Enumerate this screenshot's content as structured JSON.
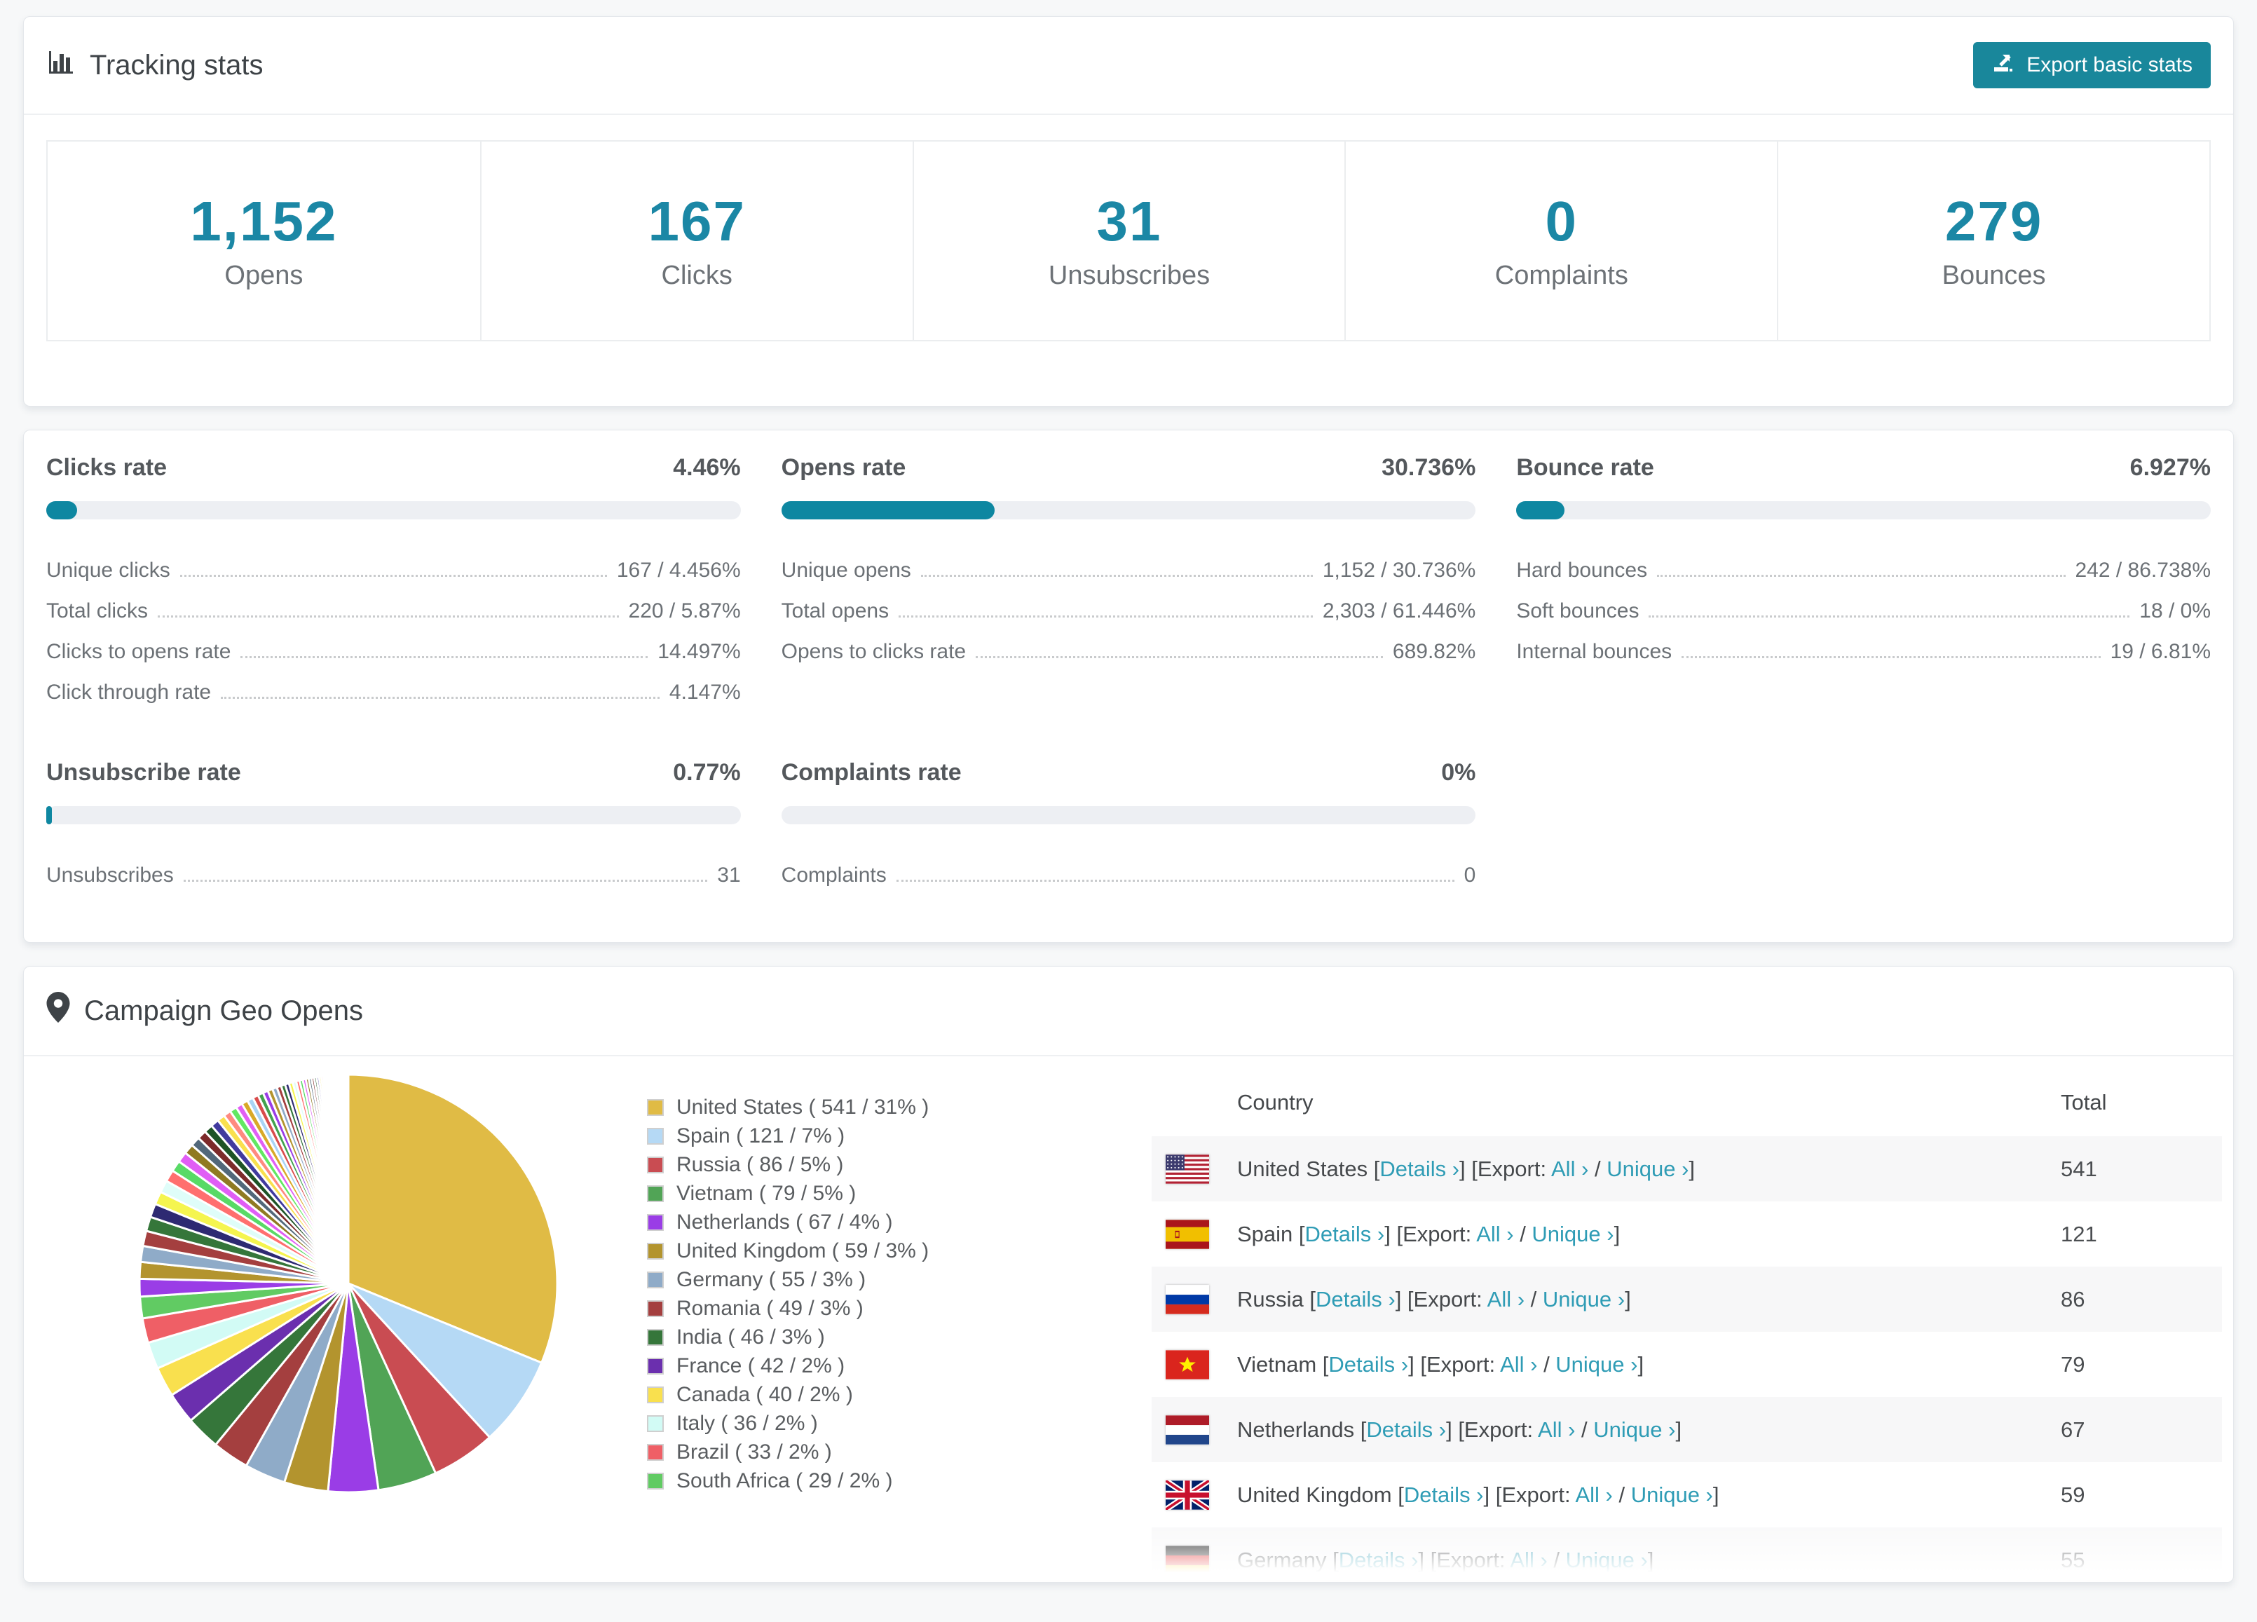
{
  "tracking": {
    "title": "Tracking stats",
    "export_label": "Export basic stats",
    "stats": [
      {
        "value": "1,152",
        "label": "Opens"
      },
      {
        "value": "167",
        "label": "Clicks"
      },
      {
        "value": "31",
        "label": "Unsubscribes"
      },
      {
        "value": "0",
        "label": "Complaints"
      },
      {
        "value": "279",
        "label": "Bounces"
      }
    ]
  },
  "rates": {
    "clicks": {
      "title": "Clicks rate",
      "value": "4.46%",
      "percent": 4.46,
      "rows": [
        {
          "label": "Unique clicks",
          "value": "167 / 4.456%"
        },
        {
          "label": "Total clicks",
          "value": "220 / 5.87%"
        },
        {
          "label": "Clicks to opens rate",
          "value": "14.497%"
        },
        {
          "label": "Click through rate",
          "value": "4.147%"
        }
      ]
    },
    "opens": {
      "title": "Opens rate",
      "value": "30.736%",
      "percent": 30.736,
      "rows": [
        {
          "label": "Unique opens",
          "value": "1,152 / 30.736%"
        },
        {
          "label": "Total opens",
          "value": "2,303 / 61.446%"
        },
        {
          "label": "Opens to clicks rate",
          "value": "689.82%"
        }
      ]
    },
    "bounce": {
      "title": "Bounce rate",
      "value": "6.927%",
      "percent": 6.927,
      "rows": [
        {
          "label": "Hard bounces",
          "value": "242 / 86.738%"
        },
        {
          "label": "Soft bounces",
          "value": "18 / 0%"
        },
        {
          "label": "Internal bounces",
          "value": "19 / 6.81%"
        }
      ]
    },
    "unsubscribe": {
      "title": "Unsubscribe rate",
      "value": "0.77%",
      "percent": 0.77,
      "rows": [
        {
          "label": "Unsubscribes",
          "value": "31"
        }
      ]
    },
    "complaints": {
      "title": "Complaints rate",
      "value": "0%",
      "percent": 0,
      "rows": [
        {
          "label": "Complaints",
          "value": "0"
        }
      ]
    }
  },
  "geo": {
    "title": "Campaign Geo Opens",
    "link_details": "Details ›",
    "link_export_label": "Export:",
    "link_all": "All ›",
    "link_unique": "Unique ›",
    "table": {
      "headers": [
        "Country",
        "Total"
      ],
      "rows": [
        {
          "country": "United States",
          "flag": "us",
          "total": "541"
        },
        {
          "country": "Spain",
          "flag": "es",
          "total": "121"
        },
        {
          "country": "Russia",
          "flag": "ru",
          "total": "86"
        },
        {
          "country": "Vietnam",
          "flag": "vn",
          "total": "79"
        },
        {
          "country": "Netherlands",
          "flag": "nl",
          "total": "67"
        },
        {
          "country": "United Kingdom",
          "flag": "gb",
          "total": "59"
        },
        {
          "country": "Germany",
          "flag": "de",
          "total": "55"
        }
      ]
    }
  },
  "chart_data": {
    "type": "pie",
    "title": "Campaign Geo Opens",
    "legend_position": "right",
    "start_angle": "top",
    "direction": "clockwise",
    "entries": [
      {
        "label": "United States",
        "value": 541,
        "pct": "31%",
        "color": "#e0bb45"
      },
      {
        "label": "Spain",
        "value": 121,
        "pct": "7%",
        "color": "#b5d9f5"
      },
      {
        "label": "Russia",
        "value": 86,
        "pct": "5%",
        "color": "#c94c52"
      },
      {
        "label": "Vietnam",
        "value": 79,
        "pct": "5%",
        "color": "#51a456"
      },
      {
        "label": "Netherlands",
        "value": 67,
        "pct": "4%",
        "color": "#9a3de6"
      },
      {
        "label": "United Kingdom",
        "value": 59,
        "pct": "3%",
        "color": "#b3942e"
      },
      {
        "label": "Germany",
        "value": 55,
        "pct": "3%",
        "color": "#8fabc8"
      },
      {
        "label": "Romania",
        "value": 49,
        "pct": "3%",
        "color": "#a43f3f"
      },
      {
        "label": "India",
        "value": 46,
        "pct": "3%",
        "color": "#35763a"
      },
      {
        "label": "France",
        "value": 42,
        "pct": "2%",
        "color": "#6b2fae"
      },
      {
        "label": "Canada",
        "value": 40,
        "pct": "2%",
        "color": "#f9e04e"
      },
      {
        "label": "Italy",
        "value": 36,
        "pct": "2%",
        "color": "#d2fbf5"
      },
      {
        "label": "Brazil",
        "value": 33,
        "pct": "2%",
        "color": "#ef5f66"
      },
      {
        "label": "South Africa",
        "value": 29,
        "pct": "2%",
        "color": "#61cb63"
      }
    ],
    "others_estimated": {
      "total": 451,
      "slices": 60
    },
    "tail_palette": [
      "#9a3de6",
      "#b3942e",
      "#8fabc8",
      "#a43f3f",
      "#35763a",
      "#2e2a72",
      "#f5f54f",
      "#dffdf9",
      "#ff6f6f",
      "#58da66",
      "#e05ef5",
      "#8f7a22",
      "#52687a",
      "#7c2a2a",
      "#1e5426",
      "#413a9e",
      "#f9e04e",
      "#ff8a80",
      "#62e862",
      "#e160f5",
      "#d9a928",
      "#a9d4f5",
      "#d94c4c",
      "#42a24e"
    ]
  }
}
